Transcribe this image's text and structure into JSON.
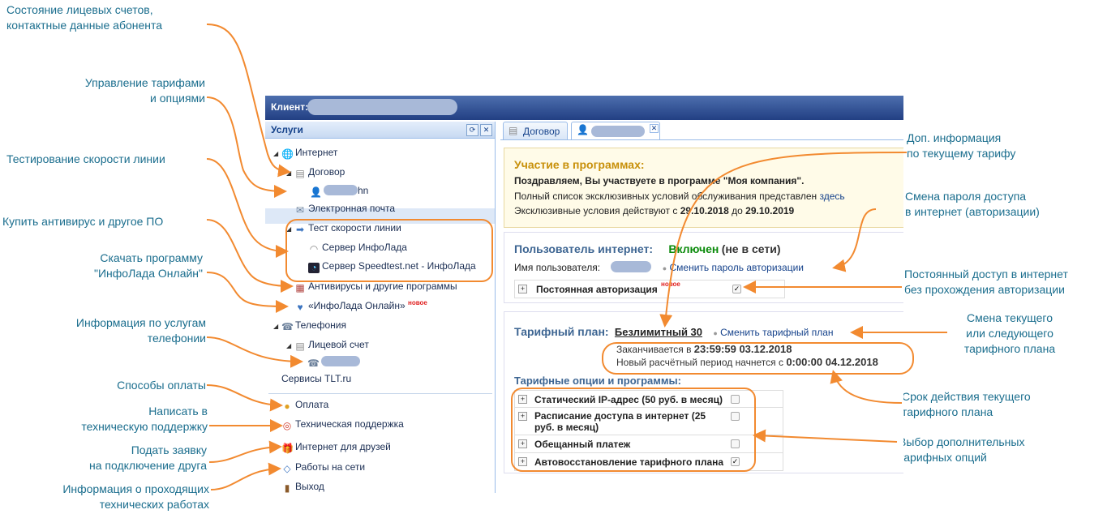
{
  "header": {
    "client_label": "Клиент:"
  },
  "sidebar": {
    "title": "Услуги",
    "items": [
      {
        "label": "Интернет"
      },
      {
        "label": "Договор"
      },
      {
        "label": "hn"
      },
      {
        "label": "Электронная почта"
      },
      {
        "label": "Тест скорости линии"
      },
      {
        "label": "Сервер ИнфоЛада"
      },
      {
        "label": "Сервер Speedtest.net - ИнфоЛада"
      },
      {
        "label": "Антивирусы и другие программы"
      },
      {
        "label": "«ИнфоЛада Онлайн»",
        "badge": "новое"
      },
      {
        "label": "Телефония"
      },
      {
        "label": "Лицевой счет"
      },
      {
        "label": "Сервисы TLT.ru"
      },
      {
        "label": "Оплата"
      },
      {
        "label": "Техническая поддержка"
      },
      {
        "label": "Интернет для друзей"
      },
      {
        "label": "Работы на сети"
      },
      {
        "label": "Выход"
      }
    ]
  },
  "tabs": [
    {
      "label": "Договор"
    }
  ],
  "program": {
    "title": "Участие в программах:",
    "line1": "Поздравляем, Вы участвуете в программе \"Моя компания\".",
    "line2": "Полный список эксклюзивных условий обслуживания представлен",
    "line2_link": "здесь",
    "line3_prefix": "Эксклюзивные условия действуют с",
    "date_from": "29.10.2018",
    "date_to_prefix": "до",
    "date_to": "29.10.2019"
  },
  "internet_user": {
    "title": "Пользователь интернет:",
    "status": "Включен",
    "status_note": "(не в сети)",
    "username_label": "Имя пользователя:",
    "change_password": "Сменить пароль авторизации",
    "permanent_auth": "Постоянная авторизация",
    "permanent_badge": "новое"
  },
  "tariff": {
    "title": "Тарифный план:",
    "plan_name": "Безлимитный 30",
    "change_plan": "Сменить тарифный план",
    "ends_prefix": "Заканчивается в",
    "ends_value": "23:59:59 03.12.2018",
    "next_prefix": "Новый расчётный период начнется с",
    "next_value": "0:00:00 04.12.2018",
    "options_title": "Тарифные опции и программы:",
    "options": [
      {
        "label": "Статический IP-адрес (50 руб. в месяц)",
        "checked": false
      },
      {
        "label": "Расписание доступа в интернет (25",
        "label2": "руб. в месяц)",
        "checked": false
      },
      {
        "label": "Обещанный платеж",
        "checked": false
      },
      {
        "label": "Автовосстановление тарифного плана",
        "checked": true
      }
    ]
  },
  "callouts": {
    "c1a": "Состояние лицевых счетов,",
    "c1b": "контактные данные абонента",
    "c2a": "Управление тарифами",
    "c2b": "и опциями",
    "c3": "Тестирование скорости линии",
    "c4": "Купить антивирус и другое ПО",
    "c5a": "Скачать программу",
    "c5b": "\"ИнфоЛада Онлайн\"",
    "c6a": "Информация по услугам",
    "c6b": "телефонии",
    "c7": "Способы оплаты",
    "c8a": "Написать в",
    "c8b": "техническую поддержку",
    "c9a": "Подать заявку",
    "c9b": "на подключение друга",
    "c10a": "Информация о проходящих",
    "c10b": "технических работах",
    "r1a": "Доп. информация",
    "r1b": "по текущему тарифу",
    "r2a": "Смена пароля доступа",
    "r2b": "в интернет (авторизации)",
    "r3a": "Постоянный доступ в интернет",
    "r3b": "без прохождения авторизации",
    "r4a": "Смена текущего",
    "r4b": "или следующего",
    "r4c": "тарифного плана",
    "r5a": "Срок действия текущего",
    "r5b": "тарифного плана",
    "r6a": "Выбор дополнительных",
    "r6b": "тарифных опций"
  },
  "colors": {
    "accent": "#f28a30",
    "callout_text": "#1b6e8e",
    "topbar": "#2a4a8c"
  }
}
